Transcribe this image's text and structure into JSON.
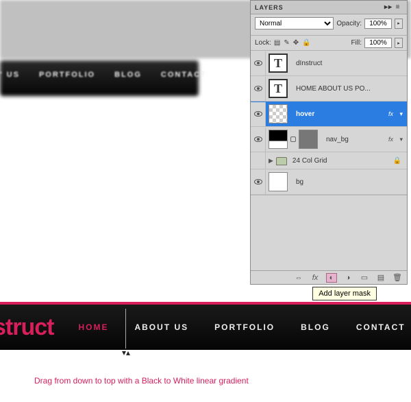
{
  "panel": {
    "title": "LAYERS",
    "blendMode": "Normal",
    "opacityLabel": "Opacity:",
    "opacityValue": "100%",
    "fillLabel": "Fill:",
    "fillValue": "100%",
    "lockLabel": "Lock:",
    "layers": [
      {
        "type": "text",
        "name": "dInstruct",
        "visible": true
      },
      {
        "type": "text",
        "name": "HOME   ABOUT US   PO...",
        "visible": true
      },
      {
        "type": "hover",
        "name": "hover",
        "visible": true,
        "selected": true,
        "fx": true
      },
      {
        "type": "navbg",
        "name": "nav_bg",
        "visible": true,
        "fx": true
      },
      {
        "type": "group",
        "name": "24 Col Grid",
        "visible": false,
        "locked": true
      },
      {
        "type": "bg",
        "name": "bg",
        "visible": true
      }
    ]
  },
  "tooltip": "Add layer mask",
  "nav": {
    "logo": "struct",
    "items": [
      "HOME",
      "ABOUT  US",
      "PORTFOLIO",
      "BLOG",
      "CONTACT"
    ],
    "activeIndex": 0
  },
  "blurredMenu": [
    "' US",
    "PORTFOLIO",
    "BLOG",
    "CONTACT"
  ],
  "caption": "Drag from down to top with a Black to White linear gradient"
}
